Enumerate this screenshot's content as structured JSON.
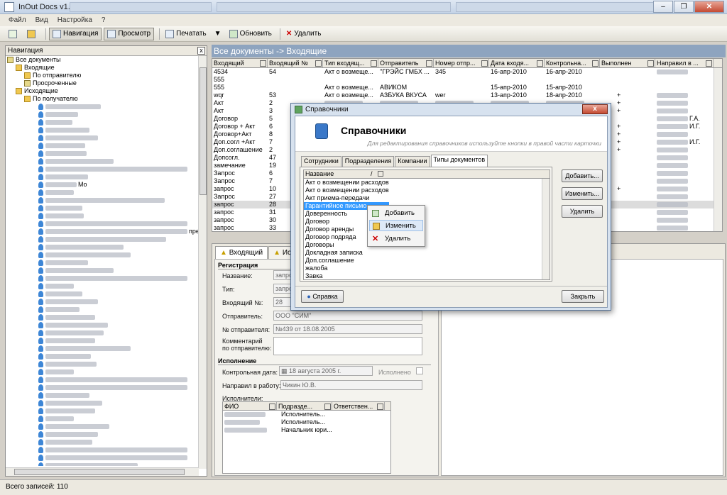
{
  "window": {
    "title": "InOut Docs v1.0"
  },
  "menu": [
    "Файл",
    "Вид",
    "Настройка",
    "?"
  ],
  "toolbar": {
    "navigation": "Навигация",
    "view": "Просмотр",
    "print": "Печатать",
    "refresh": "Обновить",
    "delete": "Удалить"
  },
  "nav": {
    "title": "Навигация",
    "close": "x",
    "tree": [
      {
        "label": "Все документы",
        "indent": 0,
        "icon": "doc"
      },
      {
        "label": "Входящие",
        "indent": 1,
        "icon": "folder"
      },
      {
        "label": "По отправителю",
        "indent": 2,
        "icon": "folder"
      },
      {
        "label": "Просроченные",
        "indent": 2,
        "icon": "doc"
      },
      {
        "label": "Исходящие",
        "indent": 1,
        "icon": "folder"
      },
      {
        "label": "По получателю",
        "indent": 2,
        "icon": "folder"
      }
    ],
    "persons": [
      "",
      "",
      "",
      "",
      "",
      "",
      "",
      "",
      "",
      "",
      "Mo",
      "",
      "",
      "",
      "",
      "",
      "пре",
      "",
      "",
      "",
      "",
      "",
      "",
      "",
      "",
      "",
      "",
      "",
      "",
      "",
      "",
      "",
      "",
      "",
      "",
      "",
      "",
      "",
      "",
      "",
      "",
      "",
      "",
      "",
      "",
      "",
      "",
      ""
    ]
  },
  "status": {
    "records": "Всего записей: 110"
  },
  "main": {
    "header": "Все документы -> Входящие",
    "columns": [
      "Входящий",
      "Входящий №",
      "Тип входящ...",
      "Отправитель",
      "Номер отпр...",
      "Дата входя...",
      "Контрольна...",
      "Выполнен",
      "Направил в ..."
    ],
    "rows": [
      [
        "4534",
        "54",
        "Акт о возмеще...",
        "\"ГРЭЙС ГМБХ ...",
        "345",
        "16-апр-2010",
        "16-апр-2010",
        "",
        ""
      ],
      [
        "555",
        "",
        "",
        "",
        "",
        "",
        "",
        "",
        ""
      ],
      [
        "555",
        "",
        "Акт о возмеще...",
        "АВИКОМ",
        "",
        "15-апр-2010",
        "15-апр-2010",
        "",
        ""
      ],
      [
        "wqr",
        "53",
        "Акт о возмеще...",
        "АЗБУКА ВКУСА",
        "wer",
        "13-апр-2010",
        "18-апр-2010",
        "+",
        ""
      ],
      [
        "Акт",
        "2",
        "",
        "",
        "",
        "",
        "",
        "+",
        ""
      ],
      [
        "Акт",
        "3",
        "",
        "",
        "",
        "",
        "",
        "+",
        ""
      ],
      [
        "Договор",
        "5",
        "",
        "",
        "",
        "",
        "",
        "",
        "Г.А."
      ],
      [
        "Договор + Акт",
        "6",
        "",
        "",
        "",
        "",
        "",
        "+",
        "И.Г."
      ],
      [
        "Договор+Акт",
        "8",
        "",
        "",
        "",
        "",
        "",
        "+",
        ""
      ],
      [
        "Доп.согл +Акт",
        "7",
        "",
        "",
        "",
        "",
        "",
        "+",
        "И.Г."
      ],
      [
        "Доп.соглашение",
        "2",
        "",
        "",
        "",
        "",
        "",
        "+",
        ""
      ],
      [
        "Допсогл.",
        "47",
        "",
        "",
        "",
        "",
        "",
        "",
        ""
      ],
      [
        "замечание",
        "19",
        "",
        "",
        "",
        "",
        "",
        "",
        ""
      ],
      [
        "Запрос",
        "6",
        "",
        "",
        "",
        "",
        "",
        "",
        ""
      ],
      [
        "Запрос",
        "7",
        "",
        "",
        "",
        "",
        "",
        "",
        ""
      ],
      [
        "запрос",
        "10",
        "",
        "",
        "",
        "",
        "",
        "+",
        ""
      ],
      [
        "Запрос",
        "27",
        "",
        "",
        "",
        "",
        "",
        "",
        ""
      ],
      [
        "запрос",
        "28",
        "",
        "",
        "",
        "",
        "",
        "",
        ""
      ],
      [
        "запрос",
        "31",
        "",
        "",
        "",
        "",
        "",
        "",
        ""
      ],
      [
        "запрос",
        "30",
        "",
        "",
        "",
        "",
        "",
        "",
        ""
      ],
      [
        "запрос",
        "33",
        "",
        "",
        "",
        "",
        "",
        "",
        ""
      ]
    ],
    "selected_row": 17
  },
  "card": {
    "tabs": [
      "Входящий",
      "Исхо"
    ],
    "section_registration": "Регистрация",
    "name_label": "Название:",
    "name_value": "запро",
    "type_label": "Тип:",
    "type_value": "запро",
    "incoming_no_label": "Входящий №:",
    "incoming_no_value": "28",
    "sender_label": "Отправитель:",
    "sender_value": "ООО \"СИМ\"",
    "sender_no_label": "№ отправителя:",
    "sender_no_value": "№439 от 18.08.2005",
    "comment_label1": "Комментарий",
    "comment_label2": "по отправителю:",
    "section_exec": "Исполнение",
    "control_date_label": "Контрольная дата:",
    "control_date_value": "18  августа  2005 г.",
    "done_label": "Исполнено",
    "sent_label": "Направил в работу:",
    "sent_value": "Чикин Ю.В.",
    "executors_label": "Исполнители:",
    "exec_columns": [
      "ФИО",
      "Подразде...",
      "Ответствен..."
    ],
    "exec_rows": [
      [
        "",
        "Исполнитель..."
      ],
      [
        "",
        "Исполнитель..."
      ],
      [
        "",
        "Начальник юри..."
      ]
    ]
  },
  "dialog": {
    "title": "Справочники",
    "close": "x",
    "header": "Справочники",
    "subtitle": "Для редактирования справочников используйте кнопки в правой части карточки",
    "tabs": [
      "Сотрудники",
      "Подразделения",
      "Компании",
      "Типы документов"
    ],
    "active_tab": 3,
    "list_header": "Название",
    "items": [
      "Акт о возмещении расходов",
      "Акт о возмещении расходов",
      "Акт приема-передачи",
      "Гарантийное письмо",
      "Доверенность",
      "Договор",
      "Договор аренды",
      "Договор подряда",
      "Договоры",
      "Докладная записка",
      "Доп.соглашение",
      "жалоба",
      "Завка"
    ],
    "selected_item": 3,
    "add": "Добавить...",
    "edit": "Изменить...",
    "delete": "Удалить",
    "help": "Справка",
    "close_button": "Закрыть"
  },
  "context_menu": {
    "add": "Добавить",
    "edit": "Изменить",
    "delete": "Удалить"
  }
}
